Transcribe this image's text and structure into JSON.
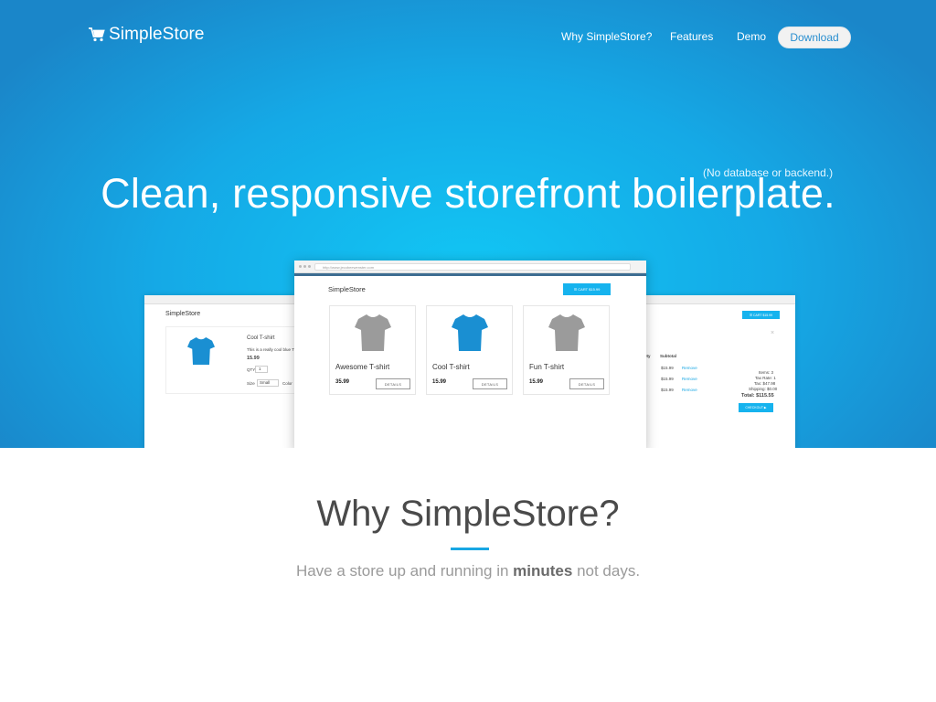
{
  "brand": {
    "name": "SimpleStore"
  },
  "nav": {
    "items": [
      "Why SimpleStore?",
      "Features",
      "Demo"
    ],
    "download_label": "Download"
  },
  "hero": {
    "note": "(No database or backend.)",
    "headline": "Clean, responsive storefront boilerplate."
  },
  "preview": {
    "url": "http://www.jecobeewenster.com",
    "store_title": "SimpleStore",
    "cart_label": "☰ CART $15.99",
    "products": [
      {
        "name": "Awesome T-shirt",
        "price": "35.99",
        "details": "DETAILS",
        "color": "#9b9b9b"
      },
      {
        "name": "Cool T-shirt",
        "price": "15.99",
        "details": "DETAILS",
        "color": "#1a8fd2"
      },
      {
        "name": "Fun T-shirt",
        "price": "15.99",
        "details": "DETAILS",
        "color": "#9b9b9b"
      }
    ],
    "left": {
      "store_title": "SimpleStore",
      "product_name": "Cool T-shirt",
      "description": "This is a really cool blue T-sh",
      "price": "15.99",
      "qty_label": "QTY",
      "qty_value": "1",
      "size_label": "Size",
      "size_value": "Small",
      "color_label": "Color"
    },
    "right": {
      "cart_label": "☰ CART $15.99",
      "col_qty": "Qty",
      "col_subtotal": "Subtotal",
      "rows": [
        {
          "price": "$15.99",
          "action": "Remove"
        },
        {
          "price": "$15.99",
          "action": "Remove"
        },
        {
          "price": "$15.99",
          "action": "Remove"
        }
      ],
      "items": "Items: 3",
      "tax_rate": "Tax Rate: 1",
      "tax": "Tax: $47.98",
      "shipping": "Shipping: $0.00",
      "total": "Total: $115.55",
      "checkout": "CHECKOUT ▶"
    }
  },
  "why": {
    "title": "Why SimpleStore?",
    "tagline_before": "Have a store up and running in ",
    "tagline_bold": "minutes",
    "tagline_after": " not days."
  },
  "colors": {
    "accent": "#18a7e3",
    "hero_center": "#12c6f4",
    "hero_edge": "#1a86c9"
  }
}
